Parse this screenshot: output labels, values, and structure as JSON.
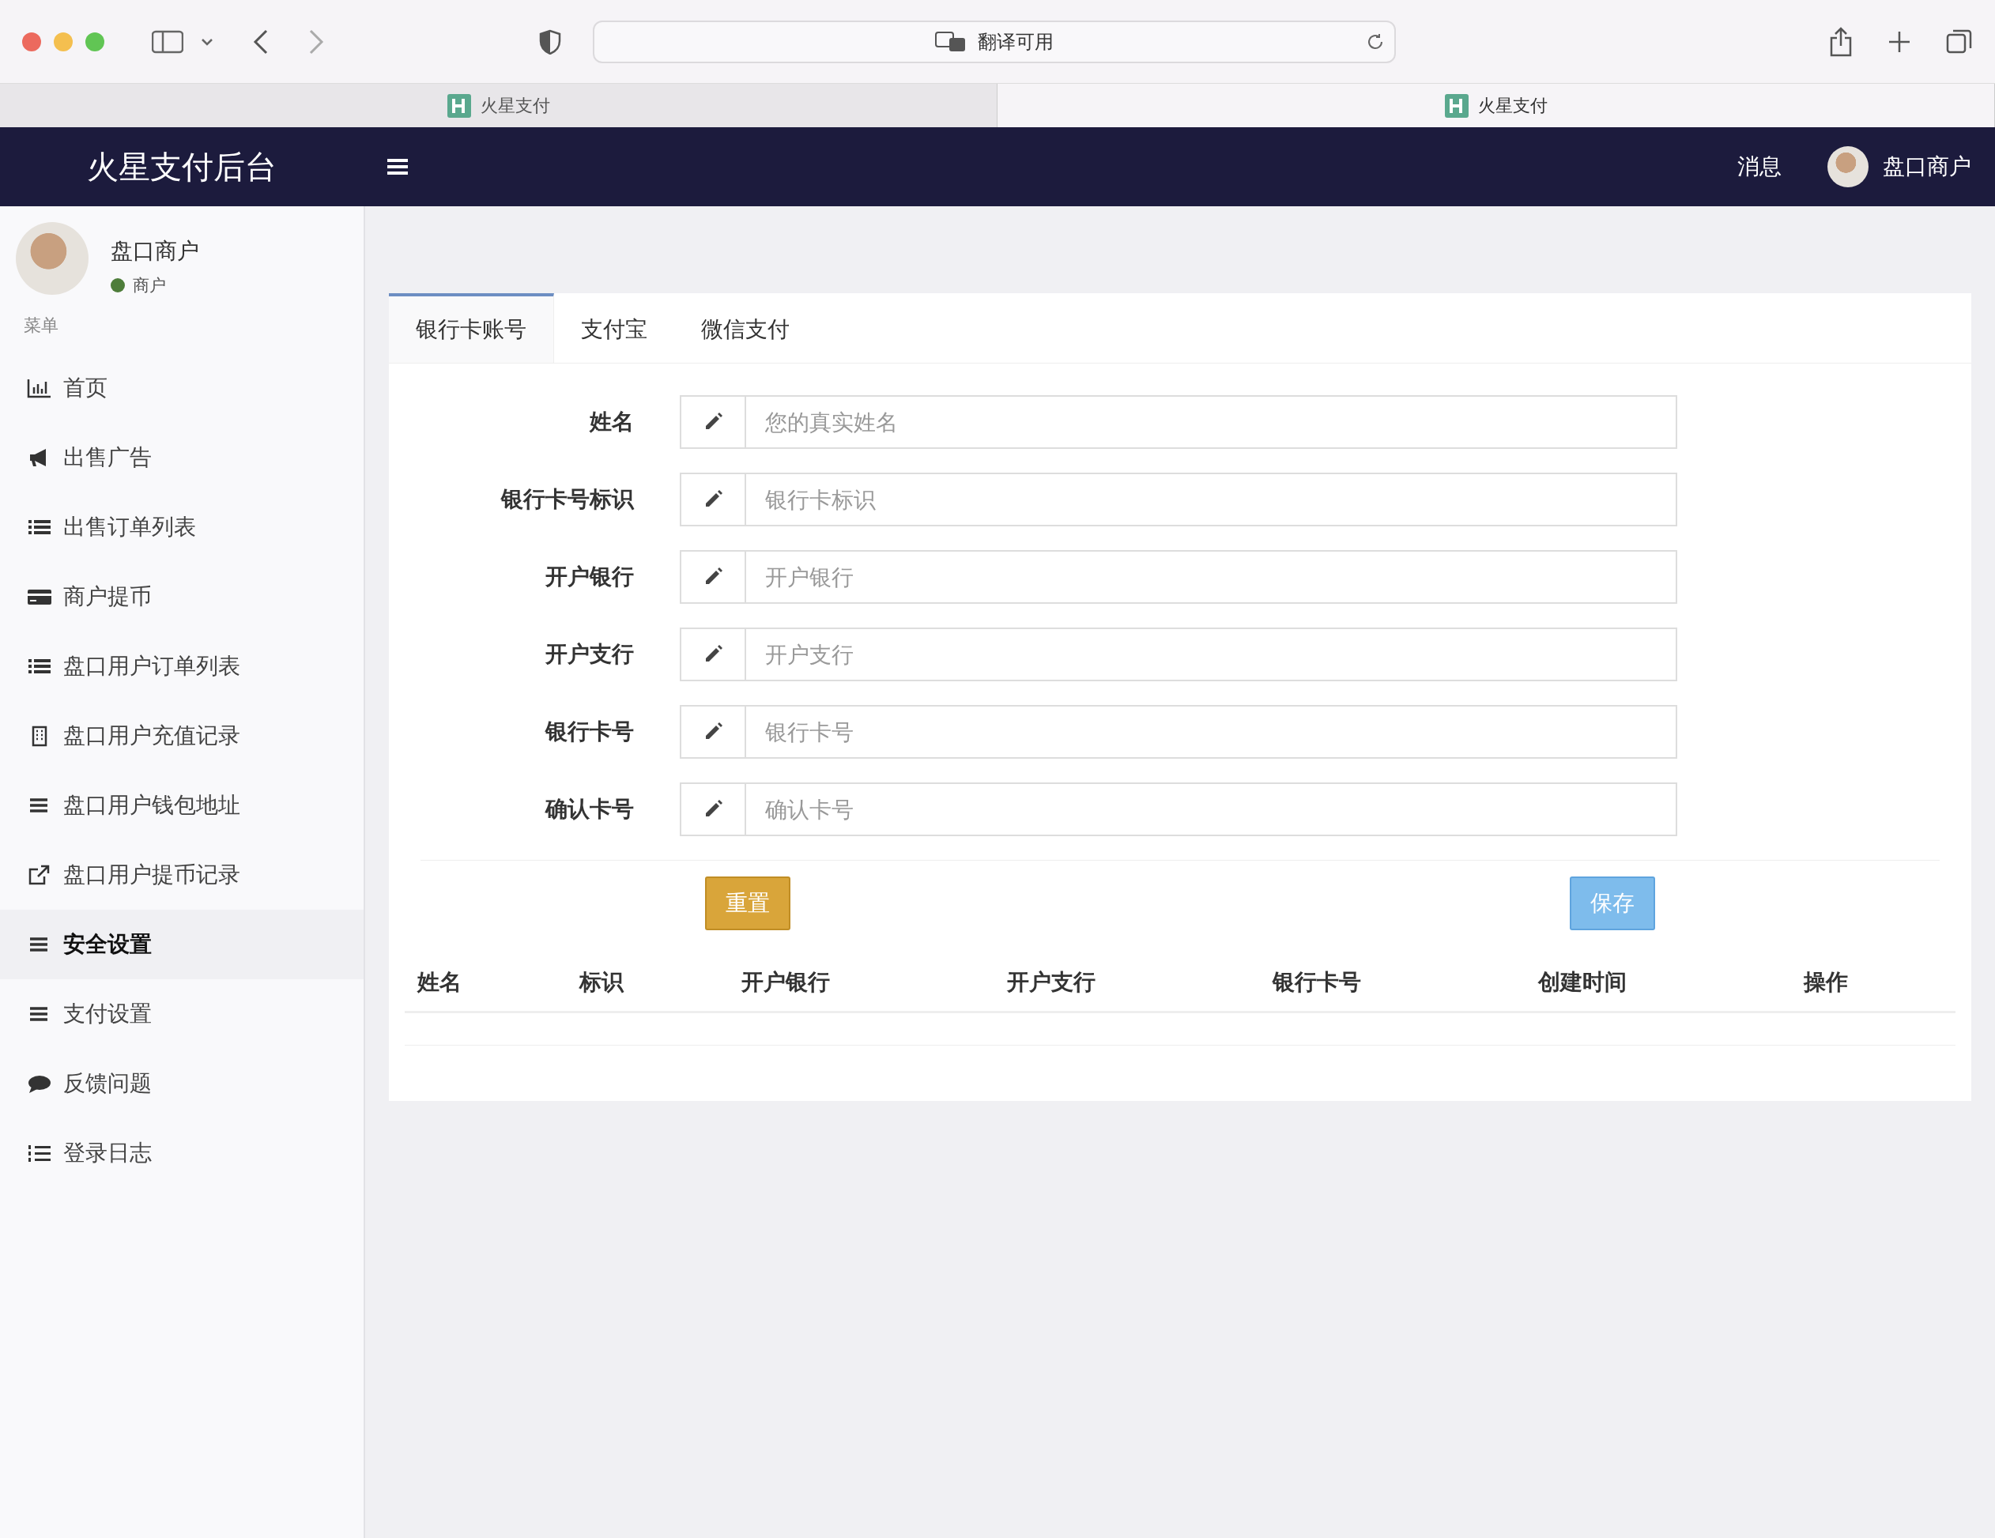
{
  "browser": {
    "address": "翻译可用",
    "tabs": [
      {
        "label": "火星支付",
        "selected": false
      },
      {
        "label": "火星支付",
        "selected": true
      }
    ]
  },
  "topbar": {
    "brand": "火星支付后台",
    "messages": "消息",
    "user": "盘口商户"
  },
  "sidebar": {
    "user": {
      "name": "盘口商户",
      "role": "商户",
      "color": "#4e7d3a"
    },
    "menu_label": "菜单",
    "items": [
      {
        "label": "首页",
        "kind": "chart",
        "selected": false
      },
      {
        "label": "出售广告",
        "kind": "bullhorn",
        "selected": false
      },
      {
        "label": "出售订单列表",
        "kind": "list",
        "selected": false
      },
      {
        "label": "商户提币",
        "kind": "card",
        "selected": false
      },
      {
        "label": "盘口用户订单列表",
        "kind": "list",
        "selected": false
      },
      {
        "label": "盘口用户充值记录",
        "kind": "building",
        "selected": false
      },
      {
        "label": "盘口用户钱包地址",
        "kind": "bars",
        "selected": false
      },
      {
        "label": "盘口用户提币记录",
        "kind": "external",
        "selected": false
      },
      {
        "label": "安全设置",
        "kind": "bars",
        "selected": true
      },
      {
        "label": "支付设置",
        "kind": "bars",
        "selected": false
      },
      {
        "label": "反馈问题",
        "kind": "comment",
        "selected": false
      },
      {
        "label": "登录日志",
        "kind": "ordered",
        "selected": false
      }
    ]
  },
  "panel": {
    "tabs": [
      {
        "label": "银行卡账号",
        "selected": true
      },
      {
        "label": "支付宝",
        "selected": false
      },
      {
        "label": "微信支付",
        "selected": false
      }
    ],
    "fields": [
      {
        "label": "姓名",
        "placeholder": "您的真实姓名"
      },
      {
        "label": "银行卡号标识",
        "placeholder": "银行卡标识"
      },
      {
        "label": "开户银行",
        "placeholder": "开户银行"
      },
      {
        "label": "开户支行",
        "placeholder": "开户支行"
      },
      {
        "label": "银行卡号",
        "placeholder": "银行卡号"
      },
      {
        "label": "确认卡号",
        "placeholder": "确认卡号"
      }
    ],
    "reset_button": "重置",
    "save_button": "保存",
    "table": {
      "columns": [
        "姓名",
        "标识",
        "开户银行",
        "开户支行",
        "银行卡号",
        "创建时间",
        "操作"
      ]
    }
  }
}
